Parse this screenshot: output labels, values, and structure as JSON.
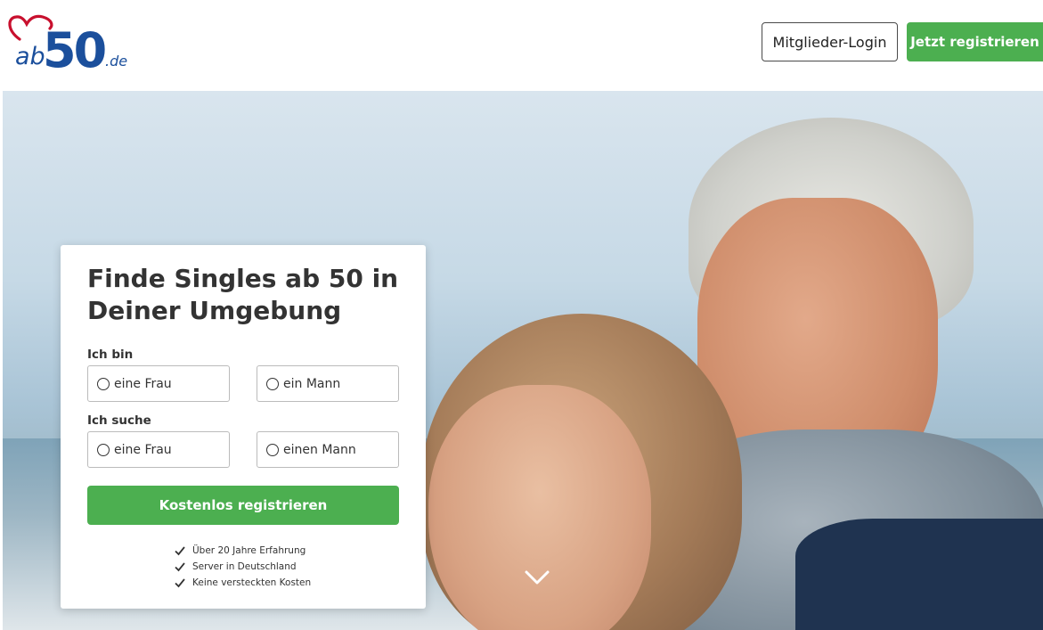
{
  "header": {
    "logo": {
      "prefix": "ab",
      "number": "50",
      "tld": ".de"
    },
    "login_label": "Mitglieder-Login",
    "register_label": "Jetzt registrieren"
  },
  "card": {
    "title": "Finde Singles ab 50 in Deiner Umgebung",
    "i_am": {
      "label": "Ich bin",
      "options": [
        "eine Frau",
        "ein Mann"
      ]
    },
    "looking_for": {
      "label": "Ich suche",
      "options": [
        "eine Frau",
        "einen Mann"
      ]
    },
    "submit_label": "Kostenlos registrieren",
    "features": [
      "Über 20 Jahre Erfahrung",
      "Server in Deutschland",
      "Keine versteckten Kosten"
    ]
  },
  "colors": {
    "brand_green": "#4caf50",
    "logo_blue": "#1b4f9c",
    "logo_red": "#c8102e"
  },
  "icons": [
    "heart-icon",
    "radio-icon",
    "check-icon",
    "chevron-down-icon"
  ]
}
